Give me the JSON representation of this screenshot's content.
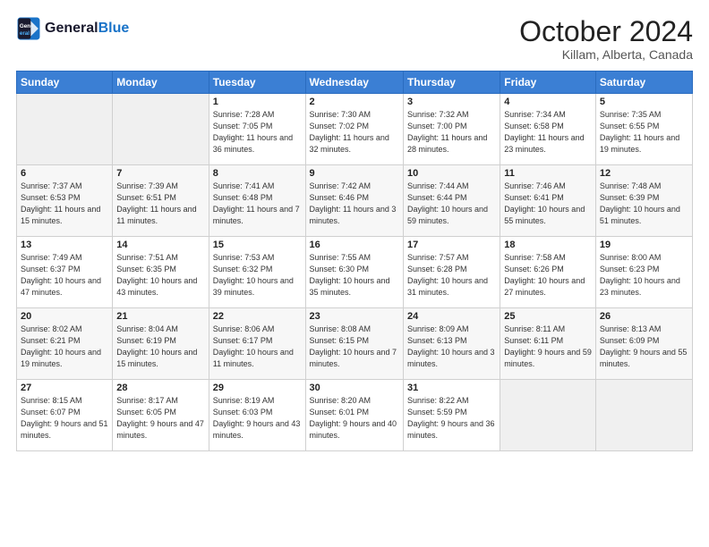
{
  "header": {
    "logo_line1": "General",
    "logo_line2": "Blue",
    "month_title": "October 2024",
    "location": "Killam, Alberta, Canada"
  },
  "weekdays": [
    "Sunday",
    "Monday",
    "Tuesday",
    "Wednesday",
    "Thursday",
    "Friday",
    "Saturday"
  ],
  "rows": [
    [
      {
        "day": "",
        "text": ""
      },
      {
        "day": "",
        "text": ""
      },
      {
        "day": "1",
        "text": "Sunrise: 7:28 AM\nSunset: 7:05 PM\nDaylight: 11 hours and 36 minutes."
      },
      {
        "day": "2",
        "text": "Sunrise: 7:30 AM\nSunset: 7:02 PM\nDaylight: 11 hours and 32 minutes."
      },
      {
        "day": "3",
        "text": "Sunrise: 7:32 AM\nSunset: 7:00 PM\nDaylight: 11 hours and 28 minutes."
      },
      {
        "day": "4",
        "text": "Sunrise: 7:34 AM\nSunset: 6:58 PM\nDaylight: 11 hours and 23 minutes."
      },
      {
        "day": "5",
        "text": "Sunrise: 7:35 AM\nSunset: 6:55 PM\nDaylight: 11 hours and 19 minutes."
      }
    ],
    [
      {
        "day": "6",
        "text": "Sunrise: 7:37 AM\nSunset: 6:53 PM\nDaylight: 11 hours and 15 minutes."
      },
      {
        "day": "7",
        "text": "Sunrise: 7:39 AM\nSunset: 6:51 PM\nDaylight: 11 hours and 11 minutes."
      },
      {
        "day": "8",
        "text": "Sunrise: 7:41 AM\nSunset: 6:48 PM\nDaylight: 11 hours and 7 minutes."
      },
      {
        "day": "9",
        "text": "Sunrise: 7:42 AM\nSunset: 6:46 PM\nDaylight: 11 hours and 3 minutes."
      },
      {
        "day": "10",
        "text": "Sunrise: 7:44 AM\nSunset: 6:44 PM\nDaylight: 10 hours and 59 minutes."
      },
      {
        "day": "11",
        "text": "Sunrise: 7:46 AM\nSunset: 6:41 PM\nDaylight: 10 hours and 55 minutes."
      },
      {
        "day": "12",
        "text": "Sunrise: 7:48 AM\nSunset: 6:39 PM\nDaylight: 10 hours and 51 minutes."
      }
    ],
    [
      {
        "day": "13",
        "text": "Sunrise: 7:49 AM\nSunset: 6:37 PM\nDaylight: 10 hours and 47 minutes."
      },
      {
        "day": "14",
        "text": "Sunrise: 7:51 AM\nSunset: 6:35 PM\nDaylight: 10 hours and 43 minutes."
      },
      {
        "day": "15",
        "text": "Sunrise: 7:53 AM\nSunset: 6:32 PM\nDaylight: 10 hours and 39 minutes."
      },
      {
        "day": "16",
        "text": "Sunrise: 7:55 AM\nSunset: 6:30 PM\nDaylight: 10 hours and 35 minutes."
      },
      {
        "day": "17",
        "text": "Sunrise: 7:57 AM\nSunset: 6:28 PM\nDaylight: 10 hours and 31 minutes."
      },
      {
        "day": "18",
        "text": "Sunrise: 7:58 AM\nSunset: 6:26 PM\nDaylight: 10 hours and 27 minutes."
      },
      {
        "day": "19",
        "text": "Sunrise: 8:00 AM\nSunset: 6:23 PM\nDaylight: 10 hours and 23 minutes."
      }
    ],
    [
      {
        "day": "20",
        "text": "Sunrise: 8:02 AM\nSunset: 6:21 PM\nDaylight: 10 hours and 19 minutes."
      },
      {
        "day": "21",
        "text": "Sunrise: 8:04 AM\nSunset: 6:19 PM\nDaylight: 10 hours and 15 minutes."
      },
      {
        "day": "22",
        "text": "Sunrise: 8:06 AM\nSunset: 6:17 PM\nDaylight: 10 hours and 11 minutes."
      },
      {
        "day": "23",
        "text": "Sunrise: 8:08 AM\nSunset: 6:15 PM\nDaylight: 10 hours and 7 minutes."
      },
      {
        "day": "24",
        "text": "Sunrise: 8:09 AM\nSunset: 6:13 PM\nDaylight: 10 hours and 3 minutes."
      },
      {
        "day": "25",
        "text": "Sunrise: 8:11 AM\nSunset: 6:11 PM\nDaylight: 9 hours and 59 minutes."
      },
      {
        "day": "26",
        "text": "Sunrise: 8:13 AM\nSunset: 6:09 PM\nDaylight: 9 hours and 55 minutes."
      }
    ],
    [
      {
        "day": "27",
        "text": "Sunrise: 8:15 AM\nSunset: 6:07 PM\nDaylight: 9 hours and 51 minutes."
      },
      {
        "day": "28",
        "text": "Sunrise: 8:17 AM\nSunset: 6:05 PM\nDaylight: 9 hours and 47 minutes."
      },
      {
        "day": "29",
        "text": "Sunrise: 8:19 AM\nSunset: 6:03 PM\nDaylight: 9 hours and 43 minutes."
      },
      {
        "day": "30",
        "text": "Sunrise: 8:20 AM\nSunset: 6:01 PM\nDaylight: 9 hours and 40 minutes."
      },
      {
        "day": "31",
        "text": "Sunrise: 8:22 AM\nSunset: 5:59 PM\nDaylight: 9 hours and 36 minutes."
      },
      {
        "day": "",
        "text": ""
      },
      {
        "day": "",
        "text": ""
      }
    ]
  ]
}
